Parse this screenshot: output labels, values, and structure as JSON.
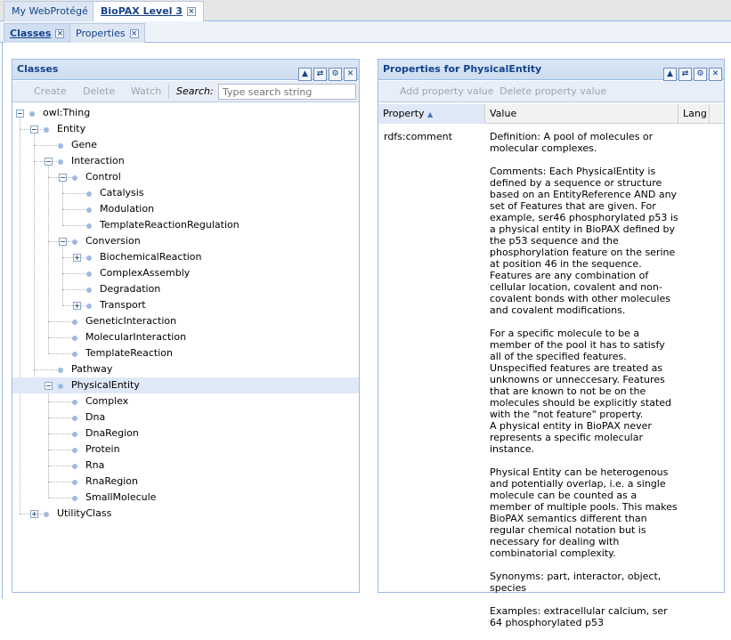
{
  "top_tabs": [
    {
      "label": "My WebProtégé"
    },
    {
      "label": "BioPAX Level 3"
    }
  ],
  "sub_tabs": [
    {
      "label": "Classes"
    },
    {
      "label": "Properties"
    }
  ],
  "close_glyph": "×",
  "classes_panel": {
    "title": "Classes",
    "toolbar": {
      "create": "Create",
      "delete": "Delete",
      "watch": "Watch",
      "search_label": "Search:",
      "search_placeholder": "Type search string"
    },
    "tree": [
      {
        "label": "owl:Thing",
        "expander": "−"
      },
      {
        "label": "Entity",
        "expander": "−"
      },
      {
        "label": "Gene",
        "expander": ""
      },
      {
        "label": "Interaction",
        "expander": "−"
      },
      {
        "label": "Control",
        "expander": "−"
      },
      {
        "label": "Catalysis",
        "expander": ""
      },
      {
        "label": "Modulation",
        "expander": ""
      },
      {
        "label": "TemplateReactionRegulation",
        "expander": ""
      },
      {
        "label": "Conversion",
        "expander": "−"
      },
      {
        "label": "BiochemicalReaction",
        "expander": "+"
      },
      {
        "label": "ComplexAssembly",
        "expander": ""
      },
      {
        "label": "Degradation",
        "expander": ""
      },
      {
        "label": "Transport",
        "expander": "+"
      },
      {
        "label": "GeneticInteraction",
        "expander": ""
      },
      {
        "label": "MolecularInteraction",
        "expander": ""
      },
      {
        "label": "TemplateReaction",
        "expander": ""
      },
      {
        "label": "Pathway",
        "expander": ""
      },
      {
        "label": "PhysicalEntity",
        "expander": "−",
        "selected": true
      },
      {
        "label": "Complex",
        "expander": ""
      },
      {
        "label": "Dna",
        "expander": ""
      },
      {
        "label": "DnaRegion",
        "expander": ""
      },
      {
        "label": "Protein",
        "expander": ""
      },
      {
        "label": "Rna",
        "expander": ""
      },
      {
        "label": "RnaRegion",
        "expander": ""
      },
      {
        "label": "SmallMolecule",
        "expander": ""
      },
      {
        "label": "UtilityClass",
        "expander": "+"
      }
    ]
  },
  "properties_panel": {
    "title": "Properties for PhysicalEntity",
    "toolbar": {
      "add": "Add property value",
      "delete": "Delete property value"
    },
    "columns": {
      "property": "Property",
      "value": "Value",
      "lang": "Lang"
    },
    "rows": [
      {
        "property": "rdfs:comment",
        "value_paragraphs": [
          "Definition: A pool of molecules or molecular complexes.",
          "Comments: Each PhysicalEntity is defined by a sequence or structure based on an EntityReference AND any set of Features that are given. For example, ser46 phosphorylated p53 is a physical entity in BioPAX defined by the p53 sequence and the phosphorylation feature on the serine at position 46 in the sequence. Features are any combination of cellular location, covalent and non-covalent bonds with other molecules and covalent modifications.",
          "For a specific molecule to be a member of the pool it has to satisfy all of the specified features. Unspecified features are treated as unknowns or unneccesary. Features that are known to not be on the molecules should be explicitly stated with the \"not feature\" property.\nA physical entity in BioPAX never represents a specific molecular instance.",
          "Physical Entity can be heterogenous and potentially overlap, i.e. a single molecule can be counted as a member of multiple pools. This makes BioPAX semantics different than regular chemical notation but is necessary for dealing with combinatorial complexity.",
          "Synonyms: part, interactor, object, species",
          "Examples: extracellular calcium, ser 64 phosphorylated p53"
        ],
        "lang": ""
      }
    ]
  },
  "panel_tools": [
    "▲",
    "⇄",
    "⚙",
    "✕"
  ],
  "colors": {
    "header_text": "#15428b",
    "selection": "#dfe8f6",
    "border": "#99bbe8"
  }
}
